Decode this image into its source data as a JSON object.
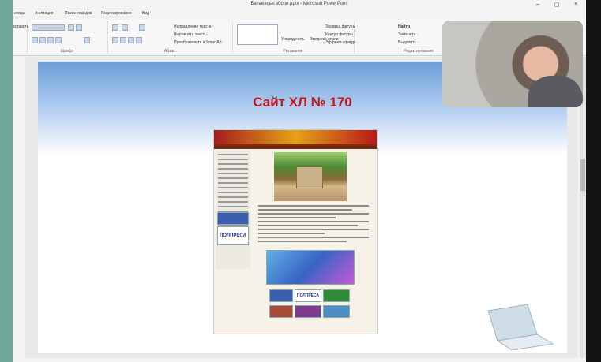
{
  "window": {
    "title": "Батьківські збори.pptx - Microsoft PowerPoint",
    "controls": [
      "–",
      "▢",
      "×"
    ]
  },
  "menu": [
    "еходы",
    "Анимация",
    "Показ слайдов",
    "Рецензирование",
    "Вид"
  ],
  "ribbon": {
    "groups": [
      {
        "label": "Шрифт"
      },
      {
        "label": "Абзац"
      },
      {
        "label": "Рисование"
      },
      {
        "label": "Редактирование"
      }
    ],
    "paste_label": "вставить",
    "text_direction": "Направление текста ·",
    "align_text": "Выровнять текст ·",
    "convert_smartart": "Преобразовать в SmartArt ·",
    "arrange": "Упорядочить",
    "quick_styles": "Экспресс-стили",
    "shape_fill": "Заливка фигуры ·",
    "shape_outline": "Контур фигуры ·",
    "shape_effects": "Эффекты фигур ·",
    "find": "Найти",
    "replace": "Заменить ·",
    "select": "Выделить ·"
  },
  "slide": {
    "title": "Сайт ХЛ № 170",
    "site_badges": [
      "ПОЛПРЕСА",
      "ПОЛПРЕСА"
    ]
  },
  "colors": {
    "title_red": "#c0161b",
    "desktop_teal": "#6fa898"
  }
}
